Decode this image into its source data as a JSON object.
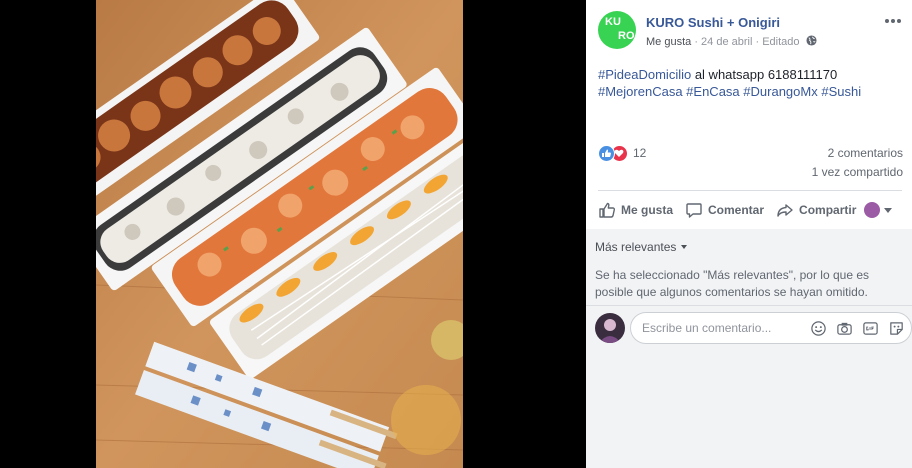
{
  "post": {
    "page_name": "KURO Sushi + Onigiri",
    "avatar_text": "KURO",
    "like_link": "Me gusta",
    "date": "24 de abril",
    "edited": "Editado",
    "text_part1": "#PideaDomicilio",
    "text_part2": " al whatsapp 6188111170",
    "hashtags": [
      "#MejorenCasa",
      "#EnCasa",
      "#DurangoMx",
      "#Sushi"
    ]
  },
  "stats": {
    "reaction_count": "12",
    "comments": "2 comentarios",
    "shares": "1 vez compartido"
  },
  "actions": {
    "like": "Me gusta",
    "comment": "Comentar",
    "share": "Compartir"
  },
  "comments": {
    "filter": "Más relevantes",
    "note": "Se ha seleccionado \"Más relevantes\", por lo que es posible que algunos comentarios se hayan omitido.",
    "placeholder": "Escribe un comentario..."
  },
  "colors": {
    "brand_green": "#39d353",
    "link_blue": "#385898",
    "like_blue": "#4a90e2",
    "love_red": "#e8334a"
  },
  "icons": [
    "globe-icon",
    "more-options-icon",
    "like-reaction-icon",
    "love-reaction-icon",
    "thumbs-up-icon",
    "comment-icon",
    "share-icon",
    "emoji-icon",
    "camera-icon",
    "gif-icon",
    "sticker-icon"
  ]
}
